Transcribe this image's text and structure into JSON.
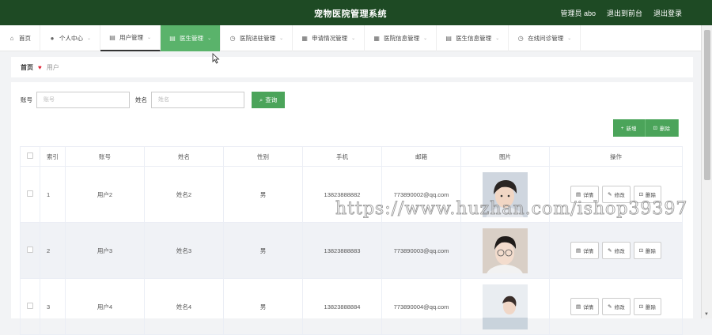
{
  "header": {
    "title": "宠物医院管理系统",
    "admin": "管理员 abo",
    "back_to_front": "退出到前台",
    "logout": "退出登录"
  },
  "nav": [
    {
      "label": "首页",
      "icon": "home-icon",
      "glyph": "⌂",
      "chevron": false
    },
    {
      "label": "个人中心",
      "icon": "user-icon",
      "glyph": "●",
      "chevron": true
    },
    {
      "label": "用户管理",
      "icon": "doc-icon",
      "glyph": "▤",
      "chevron": true
    },
    {
      "label": "医生管理",
      "icon": "doc-icon",
      "glyph": "▤",
      "chevron": true
    },
    {
      "label": "医院进驻管理",
      "icon": "clock-icon",
      "glyph": "◷",
      "chevron": true
    },
    {
      "label": "申请情况管理",
      "icon": "grid-icon",
      "glyph": "▦",
      "chevron": true
    },
    {
      "label": "医院信息管理",
      "icon": "grid-icon",
      "glyph": "▦",
      "chevron": true
    },
    {
      "label": "医生信息管理",
      "icon": "doc-icon",
      "glyph": "▤",
      "chevron": true
    },
    {
      "label": "在线问诊管理",
      "icon": "clock-icon",
      "glyph": "◷",
      "chevron": true
    }
  ],
  "breadcrumb": {
    "home": "首页",
    "current": "用户"
  },
  "search": {
    "account_label": "账号",
    "account_placeholder": "账号",
    "name_label": "姓名",
    "name_placeholder": "姓名",
    "button": "查询"
  },
  "actions": {
    "add": "新增",
    "delete": "删除"
  },
  "table": {
    "headers": [
      "",
      "索引",
      "账号",
      "姓名",
      "性别",
      "手机",
      "邮箱",
      "图片",
      "操作"
    ],
    "rows": [
      {
        "index": "1",
        "account": "用户2",
        "name": "姓名2",
        "gender": "男",
        "phone": "13823888882",
        "email": "773890002@qq.com"
      },
      {
        "index": "2",
        "account": "用户3",
        "name": "姓名3",
        "gender": "男",
        "phone": "13823888883",
        "email": "773890003@qq.com"
      },
      {
        "index": "3",
        "account": "用户4",
        "name": "姓名4",
        "gender": "男",
        "phone": "13823888884",
        "email": "773890004@qq.com"
      }
    ],
    "ops": {
      "detail": "详情",
      "edit": "修改",
      "remove": "删除"
    }
  },
  "watermark": "https://www.huzhan.com/ishop39397",
  "colors": {
    "header_bg": "#1e4a24",
    "accent": "#4ba45a",
    "nav_hover": "#5ab36b",
    "heart": "#e0293b"
  }
}
